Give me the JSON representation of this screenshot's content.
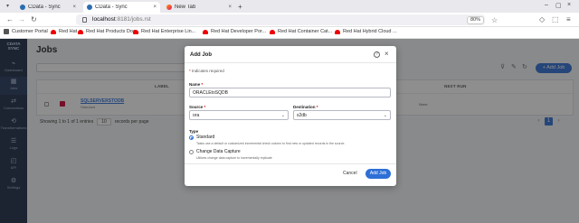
{
  "browser": {
    "tabs": [
      {
        "label": "CData - Sync",
        "active": false
      },
      {
        "label": "CData - Sync",
        "active": true
      },
      {
        "label": "New Tab",
        "active": false
      }
    ],
    "url_host": "localhost",
    "url_path": ":8181/jobs.rst",
    "zoom": "80%",
    "bookmarks": [
      "Customer Portal",
      "Red Hat",
      "Red Hat Products Doc...",
      "Red Hat Enterprise Lin...",
      "Red Hat Developer Por...",
      "Red Hat Container Cat...",
      "Red Hat Hybrid Cloud ..."
    ]
  },
  "app": {
    "logo_line1": "CDATA",
    "logo_line2": "SYNC",
    "sidebar": [
      "Dashboard",
      "Jobs",
      "Connections",
      "Transformations",
      "Logs",
      "API",
      "Settings"
    ],
    "page_title": "Jobs",
    "add_job_button": "+ Add Job",
    "table": {
      "headers": [
        "LABEL",
        "NEXT RUN"
      ],
      "row": {
        "name": "SQLSERVERSTODB",
        "type": "Standard",
        "next_run": "None"
      }
    },
    "footer": {
      "showing": "Showing 1 to 1 of 1 entries",
      "page_size": "10",
      "per_page": "records per page",
      "page": "1"
    }
  },
  "modal": {
    "title": "Add Job",
    "required_note": "Indicates required",
    "name_label": "Name",
    "name_value": "ORACLEtoSQDB",
    "source_label": "Source",
    "source_value": "ora",
    "destination_label": "Destination",
    "destination_value": "s2db",
    "type_label": "Type",
    "option_standard": "Standard",
    "option_standard_desc": "Tasks use a default or customized incremental check column to find new or updated records in the source.",
    "option_cdc": "Change Data Capture",
    "option_cdc_desc": "Utilizes change data capture to incrementally replicate",
    "cancel": "Cancel",
    "add": "Add Job"
  }
}
